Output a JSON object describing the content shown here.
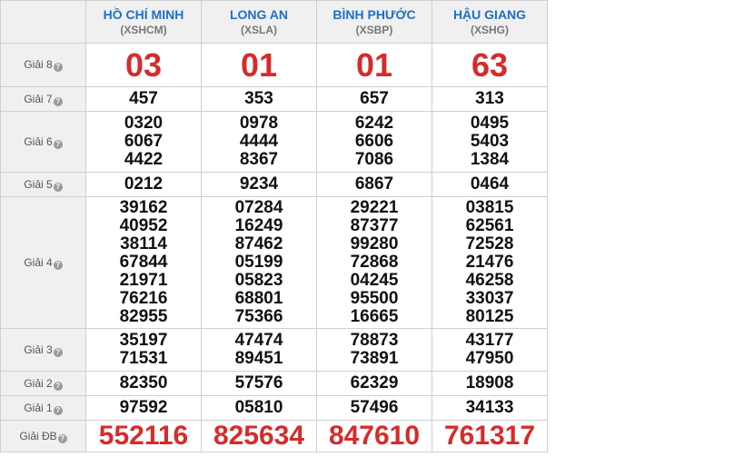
{
  "provinces": [
    {
      "name": "HỒ CHÍ MINH",
      "code": "(XSHCM)"
    },
    {
      "name": "LONG AN",
      "code": "(XSLA)"
    },
    {
      "name": "BÌNH PHƯỚC",
      "code": "(XSBP)"
    },
    {
      "name": "HẬU GIANG",
      "code": "(XSHG)"
    }
  ],
  "help_icon": "question-circle-icon",
  "help_glyph": "?",
  "prizes": [
    {
      "key": "g8",
      "label": "Giải 8",
      "style": "big",
      "results": [
        [
          "03"
        ],
        [
          "01"
        ],
        [
          "01"
        ],
        [
          "63"
        ]
      ]
    },
    {
      "key": "g7",
      "label": "Giải 7",
      "style": "normal",
      "results": [
        [
          "457"
        ],
        [
          "353"
        ],
        [
          "657"
        ],
        [
          "313"
        ]
      ]
    },
    {
      "key": "g6",
      "label": "Giải 6",
      "style": "normal",
      "results": [
        [
          "0320",
          "6067",
          "4422"
        ],
        [
          "0978",
          "4444",
          "8367"
        ],
        [
          "6242",
          "6606",
          "7086"
        ],
        [
          "0495",
          "5403",
          "1384"
        ]
      ]
    },
    {
      "key": "g5",
      "label": "Giải 5",
      "style": "normal",
      "results": [
        [
          "0212"
        ],
        [
          "9234"
        ],
        [
          "6867"
        ],
        [
          "0464"
        ]
      ]
    },
    {
      "key": "g4",
      "label": "Giải 4",
      "style": "normal",
      "results": [
        [
          "39162",
          "40952",
          "38114",
          "67844",
          "21971",
          "76216",
          "82955"
        ],
        [
          "07284",
          "16249",
          "87462",
          "05199",
          "05823",
          "68801",
          "75366"
        ],
        [
          "29221",
          "87377",
          "99280",
          "72868",
          "04245",
          "95500",
          "16665"
        ],
        [
          "03815",
          "62561",
          "72528",
          "21476",
          "46258",
          "33037",
          "80125"
        ]
      ]
    },
    {
      "key": "g3",
      "label": "Giải 3",
      "style": "normal",
      "results": [
        [
          "35197",
          "71531"
        ],
        [
          "47474",
          "89451"
        ],
        [
          "78873",
          "73891"
        ],
        [
          "43177",
          "47950"
        ]
      ]
    },
    {
      "key": "g2",
      "label": "Giải 2",
      "style": "normal",
      "results": [
        [
          "82350"
        ],
        [
          "57576"
        ],
        [
          "62329"
        ],
        [
          "18908"
        ]
      ]
    },
    {
      "key": "g1",
      "label": "Giải 1",
      "style": "normal",
      "results": [
        [
          "97592"
        ],
        [
          "05810"
        ],
        [
          "57496"
        ],
        [
          "34133"
        ]
      ]
    },
    {
      "key": "gdb",
      "label": "Giải ĐB",
      "style": "db",
      "results": [
        [
          "552116"
        ],
        [
          "825634"
        ],
        [
          "847610"
        ],
        [
          "761317"
        ]
      ]
    }
  ]
}
